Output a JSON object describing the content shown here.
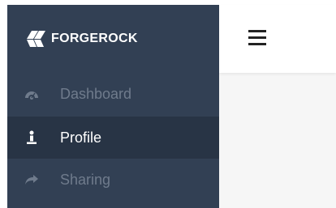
{
  "brand": {
    "name": "FORGEROCK",
    "logo_icon": "forgerock-logo-icon"
  },
  "sidebar": {
    "items": [
      {
        "label": "Dashboard",
        "icon": "tachometer-icon",
        "active": false
      },
      {
        "label": "Profile",
        "icon": "user-icon",
        "active": true
      },
      {
        "label": "Sharing",
        "icon": "share-arrow-icon",
        "active": false
      }
    ]
  },
  "topbar": {
    "menu_icon": "hamburger-menu-icon"
  },
  "colors": {
    "sidebar_bg": "#324054",
    "sidebar_active_bg": "#283445",
    "inactive_text": "#6f7b8c",
    "active_text": "#ffffff",
    "content_bg": "#f6f6f6"
  }
}
